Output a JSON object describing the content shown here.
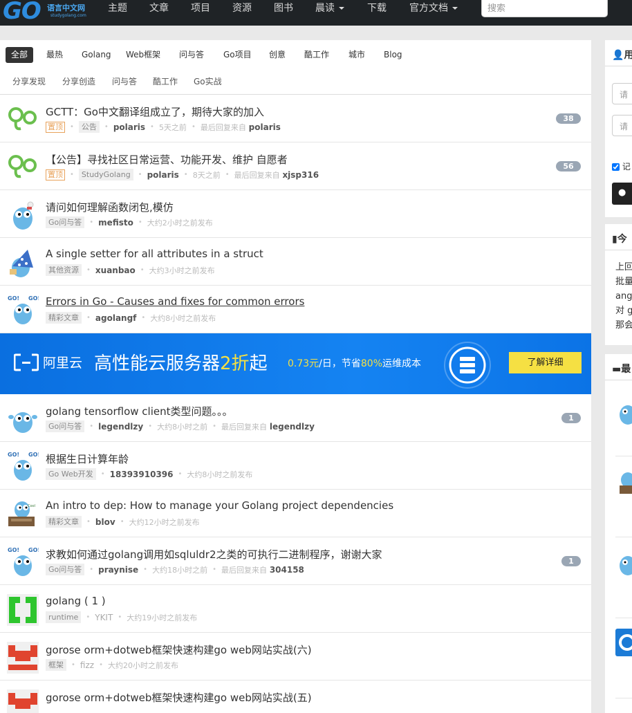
{
  "brand": {
    "logo_text": "GO",
    "name": "语言中文网",
    "url": "studygolang.com"
  },
  "nav": {
    "items": [
      "主题",
      "文章",
      "项目",
      "资源",
      "图书",
      "晨读",
      "下载",
      "官方文档"
    ],
    "search_placeholder": "搜索"
  },
  "tabs": [
    "全部",
    "最热",
    "Golang",
    "Web框架",
    "问与答",
    "Go项目",
    "创意",
    "酷工作",
    "城市",
    "Blog"
  ],
  "subtabs": [
    "分享发现",
    "分享创造",
    "问与答",
    "酷工作",
    "Go实战"
  ],
  "topics": [
    {
      "title": "GCTT：Go中文翻译组成立了，期待大家的加入",
      "top": "置顶",
      "node": "公告",
      "user": "polaris",
      "time": "5天之前",
      "reply_prefix": "最后回复来自",
      "reply_user": "polaris",
      "count": "38"
    },
    {
      "title": "【公告】寻找社区日常运营、功能开发、维护 自愿者",
      "top": "置顶",
      "node": "StudyGolang",
      "user": "polaris",
      "time": "8天之前",
      "reply_prefix": "最后回复来自",
      "reply_user": "xjsp316",
      "count": "56"
    },
    {
      "title": "请问如何理解函数闭包,模仿",
      "node": "Go问与答",
      "user": "mefisto",
      "time": "大约2小时之前发布"
    },
    {
      "title": "A single setter for all attributes in a struct",
      "node": "其他资源",
      "user": "xuanbao",
      "time": "大约3小时之前发布"
    },
    {
      "title": "Errors in Go - Causes and fixes for common errors",
      "node": "精彩文章",
      "user": "agolangf",
      "time": "大约8小时之前发布"
    }
  ],
  "ad": {
    "brand": "阿里云",
    "headline_pre": "高性能云服务器",
    "headline_hl": "2折",
    "headline_post": "起",
    "sub_price": "0.73元",
    "sub_mid": "/日，节省",
    "sub_pct": "80%",
    "sub_post": "运维成本",
    "button": "了解详细"
  },
  "topics2": [
    {
      "title": "golang tensorflow client类型问题。。。",
      "node": "Go问与答",
      "user": "legendlzy",
      "time": "大约8小时之前",
      "reply_prefix": "最后回复来自",
      "reply_user": "legendlzy",
      "count": "1"
    },
    {
      "title": "根据生日计算年龄",
      "node": "Go Web开发",
      "user": "18393910396",
      "time": "大约8小时之前发布"
    },
    {
      "title": "An intro to dep: How to manage your Golang project dependencies",
      "node": "精彩文章",
      "user": "blov",
      "time": "大约12小时之前发布"
    },
    {
      "title": "求教如何通过golang调用如sqluldr2之类的可执行二进制程序，谢谢大家",
      "node": "Go问与答",
      "user": "praynise",
      "time": "大约18小时之前",
      "reply_prefix": "最后回复来自",
      "reply_user": "304158",
      "count": "1"
    },
    {
      "title": "golang ( 1 )",
      "node": "runtime",
      "user": "YKIT",
      "time": "大约19小时之前发布"
    },
    {
      "title": "gorose orm+dotweb框架快速构建go web网站实战(六)",
      "node": "框架",
      "user": "fizz",
      "time": "大约20小时之前发布"
    },
    {
      "title": "gorose orm+dotweb框架快速构建go web网站实战(五)"
    }
  ],
  "sidebar": {
    "user_head": "用",
    "input1": "请",
    "input2": "请",
    "remember": "记",
    "today_head": "今",
    "text_lines": [
      "上回",
      "批量",
      "ang",
      "对 g",
      "那会"
    ],
    "latest_head": "最"
  },
  "colors": {
    "nav_bg": "#1f2326",
    "ad_blue": "#1583f2",
    "ad_yellow": "#f5e043",
    "badge": "#9aa6b4",
    "top_badge": "#e8a25a"
  }
}
